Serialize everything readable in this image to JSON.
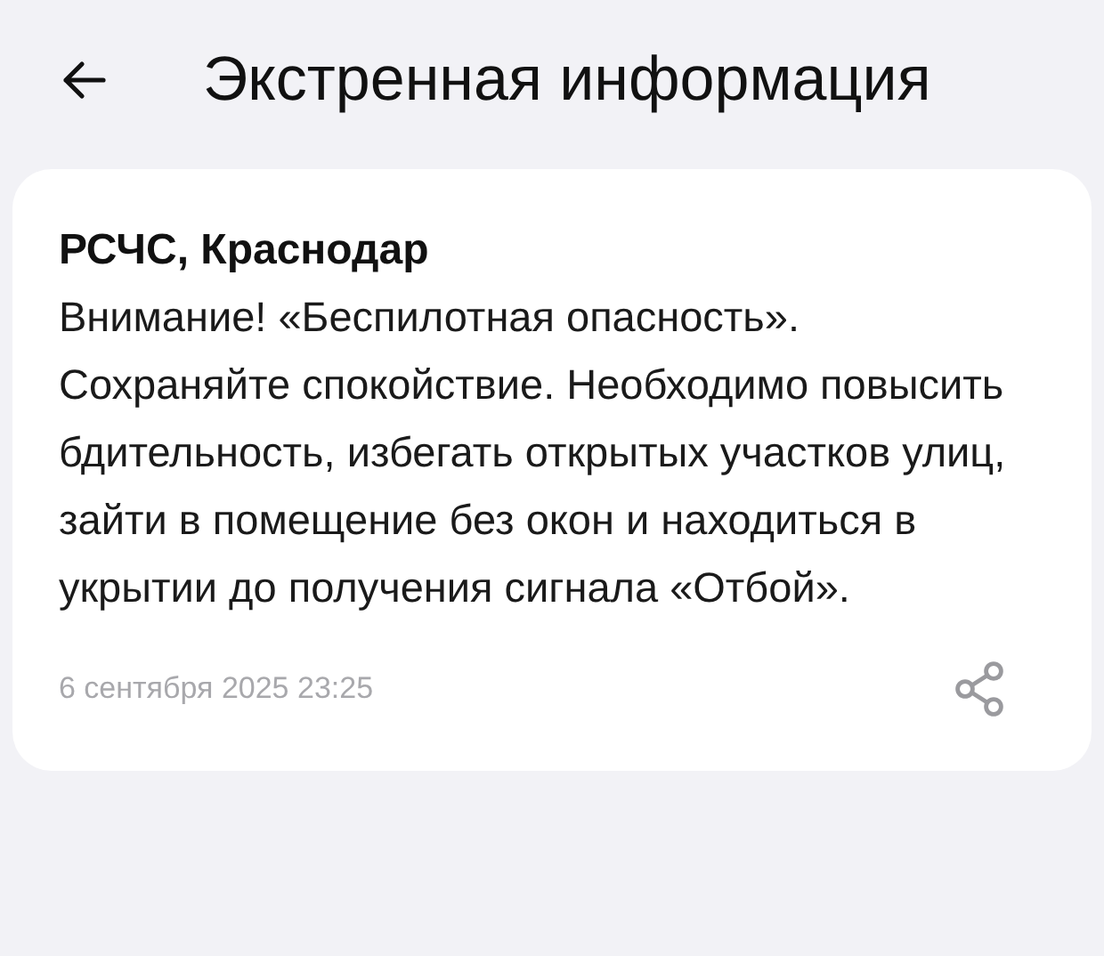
{
  "header": {
    "title": "Экстренная информация"
  },
  "alert": {
    "sender": "РСЧС, Краснодар",
    "message": "Внимание! «Беспилотная опасность». Сохраняйте спокойствие. Необходимо повысить бдительность, избегать открытых участков улиц, зайти в помещение без окон и находиться в укрытии до получения сигнала «Отбой».",
    "date": "6 сентября 2025 23:25"
  }
}
